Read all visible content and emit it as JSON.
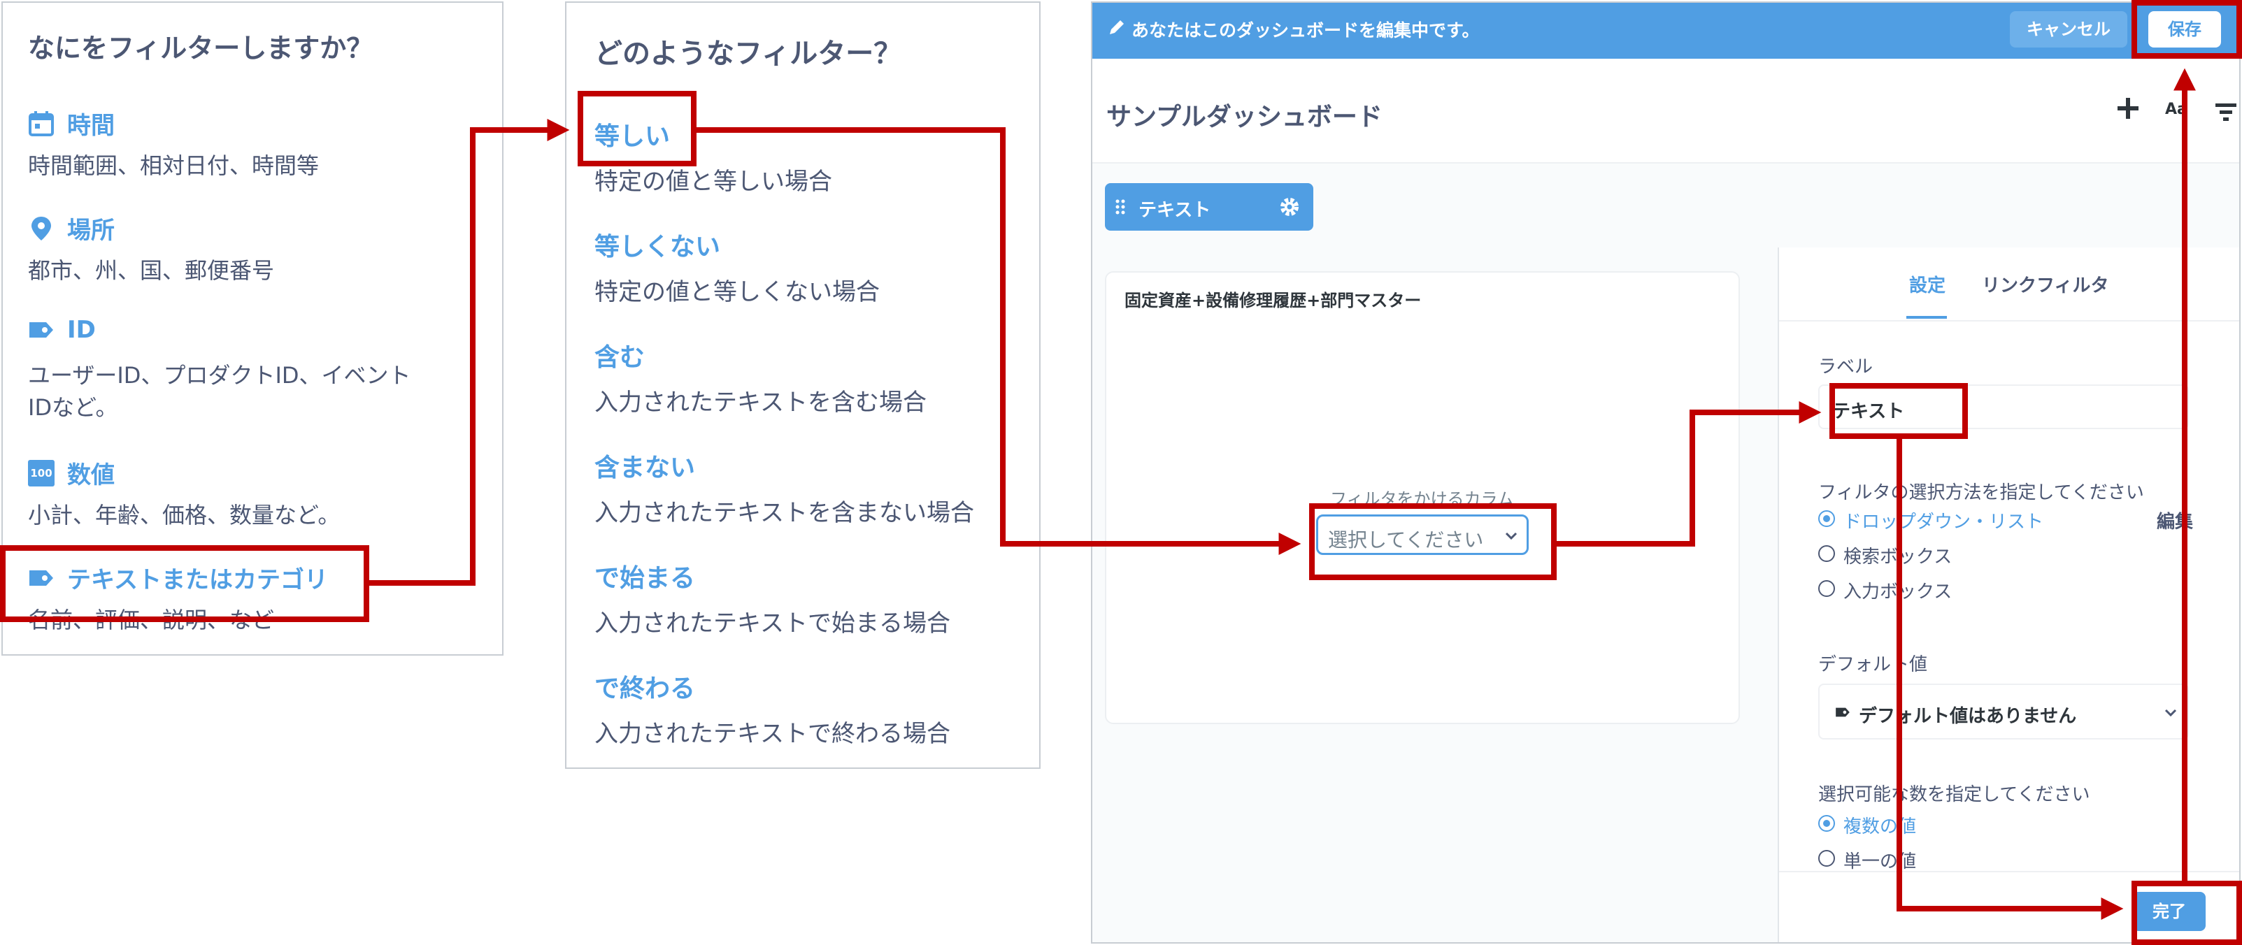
{
  "panel1": {
    "title": "なにをフィルターしますか？",
    "options": [
      {
        "icon": "calendar-icon",
        "name": "時間",
        "desc": "時間範囲、相対日付、時間等"
      },
      {
        "icon": "location-pin-icon",
        "name": "場所",
        "desc": "都市、州、国、郵便番号"
      },
      {
        "icon": "tag-icon",
        "name": "ID",
        "desc": "ユーザーID、プロダクトID、イベント",
        "desc2": "IDなど。"
      },
      {
        "icon": "number-icon",
        "icon_text": "100",
        "name": "数値",
        "desc": "小計、年齢、価格、数量など。"
      },
      {
        "icon": "tag-icon",
        "name": "テキストまたはカテゴリ",
        "desc": "名前、評価、説明、など"
      }
    ]
  },
  "panel2": {
    "title": "どのようなフィルター？",
    "types": [
      {
        "name": "等しい",
        "desc": "特定の値と等しい場合"
      },
      {
        "name": "等しくない",
        "desc": "特定の値と等しくない場合"
      },
      {
        "name": "含む",
        "desc": "入力されたテキストを含む場合"
      },
      {
        "name": "含まない",
        "desc": "入力されたテキストを含まない場合"
      },
      {
        "name": "で始まる",
        "desc": "入力されたテキストで始まる場合"
      },
      {
        "name": "で終わる",
        "desc": "入力されたテキストで終わる場合"
      }
    ]
  },
  "panel3": {
    "banner": "あなたはこのダッシュボードを編集中です。",
    "cancel_label": "キャンセル",
    "save_label": "保存",
    "dashboard_title": "サンプルダッシュボード",
    "add_icon": "plus-icon",
    "text_icon_label": "Aa",
    "filter_icon": "filter-icon",
    "filter_chip_label": "テキスト",
    "card_title": "固定資産+設備修理履歴+部門マスター",
    "column_label": "フィルタをかけるカラム",
    "column_select_placeholder": "選択してください",
    "tabs": [
      "設定",
      "リンクフィルタ"
    ],
    "label_heading": "ラベル",
    "label_value": "テキスト",
    "method_heading": "フィルタの選択方法を指定してください",
    "methods": [
      "ドロップダウン・リスト",
      "検索ボックス",
      "入力ボックス"
    ],
    "method_edit": "編集",
    "default_heading": "デフォルト値",
    "default_value": "デフォルト値はありません",
    "count_heading": "選択可能な数を指定してください",
    "counts": [
      "複数の値",
      "単一の値"
    ],
    "done_label": "完了"
  },
  "colors": {
    "accent": "#509ee3",
    "text": "#4c5773",
    "highlight": "#c00000"
  }
}
